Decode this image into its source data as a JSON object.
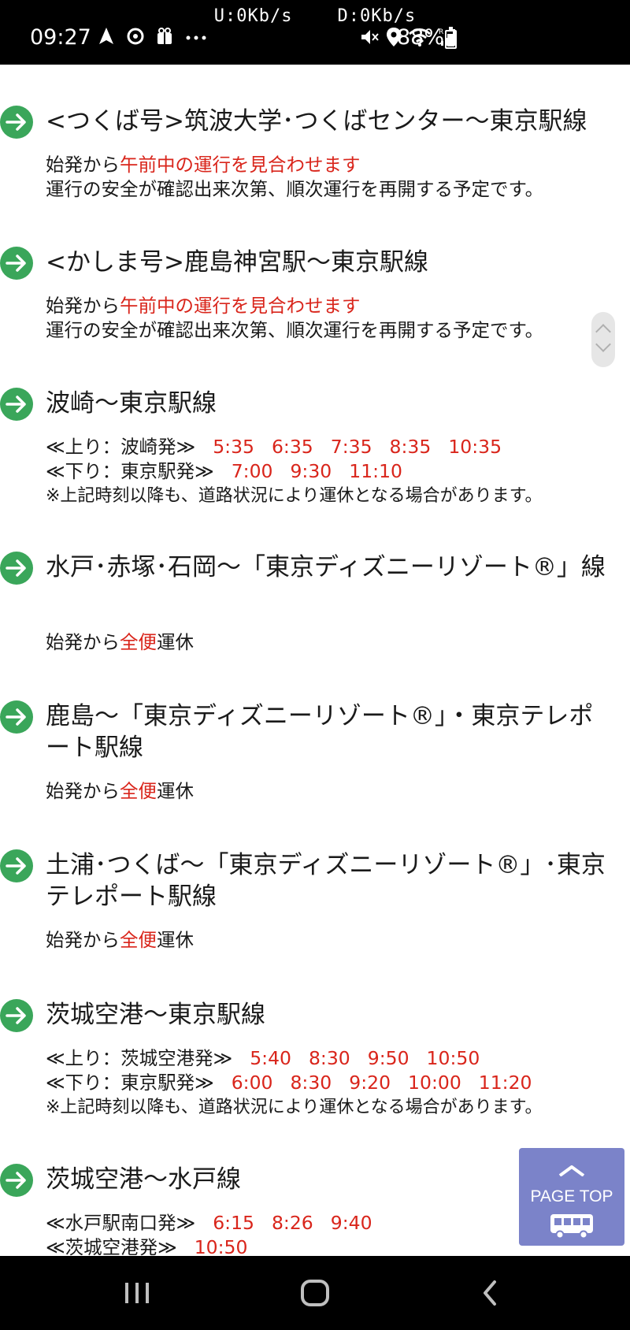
{
  "status_bar": {
    "net_speed": "U:0Kb/s    D:0Kb/s",
    "time": "09:27",
    "battery": "88%",
    "left_icons": [
      "navigation-icon",
      "sync-icon",
      "gift-icon",
      "more-icon"
    ],
    "right_icons": [
      "mute-icon",
      "location-icon",
      "wifi-icon",
      "signal-icon",
      "battery-icon"
    ]
  },
  "routes": [
    {
      "title": "<つくば号>筑波大学･つくばセンター〜東京駅線",
      "status_prefix": "始発から",
      "status_highlight": "午前中の運行を見合わせます",
      "status_suffix": "",
      "note": "運行の安全が確認出来次第、順次運行を再開する予定です。"
    },
    {
      "title": "<かしま号>鹿島神宮駅〜東京駅線",
      "status_prefix": "始発から",
      "status_highlight": "午前中の運行を見合わせます",
      "status_suffix": "",
      "note": "運行の安全が確認出来次第、順次運行を再開する予定です。"
    },
    {
      "title": "波崎〜東京駅線",
      "schedule": [
        {
          "label": "≪上り：波崎発≫",
          "times": [
            "5:35",
            "6:35",
            "7:35",
            "8:35",
            "10:35"
          ]
        },
        {
          "label": "≪下り：東京駅発≫",
          "times": [
            "7:00",
            "9:30",
            "11:10"
          ]
        }
      ],
      "note": "※上記時刻以降も、道路状況により運休となる場合があります。"
    },
    {
      "title": "水戸･赤塚･石岡〜「東京ディズニーリゾート®」線",
      "status_prefix": "始発から",
      "status_highlight": "全便",
      "status_suffix": "運休"
    },
    {
      "title": "鹿島〜「東京ディズニーリゾート®」・東京テレポート駅線",
      "status_prefix": "始発から",
      "status_highlight": "全便",
      "status_suffix": "運休"
    },
    {
      "title": "土浦･つくば〜「東京ディズニーリゾート®」･東京テレポート駅線",
      "status_prefix": "始発から",
      "status_highlight": "全便",
      "status_suffix": "運休"
    },
    {
      "title": "茨城空港〜東京駅線",
      "schedule": [
        {
          "label": "≪上り：茨城空港発≫",
          "times": [
            "5:40",
            "8:30",
            "9:50",
            "10:50"
          ]
        },
        {
          "label": "≪下り：東京駅発≫",
          "times": [
            "6:00",
            "8:30",
            "9:20",
            "10:00",
            "11:20"
          ]
        }
      ],
      "note": "※上記時刻以降も、道路状況により運休となる場合があります。"
    },
    {
      "title": "茨城空港〜水戸線",
      "schedule": [
        {
          "label": "≪水戸駅南口発≫",
          "times": [
            "6:15",
            "8:26",
            "9:40"
          ]
        },
        {
          "label": "≪茨城空港発≫",
          "times": [
            "10:50"
          ]
        }
      ]
    }
  ],
  "page_top": {
    "label": "PAGE TOP"
  },
  "nav_bar": {
    "buttons": [
      "recent-apps",
      "home",
      "back"
    ]
  },
  "colors": {
    "accent_red": "#d9251b",
    "arrow_green": "#3aa65a",
    "page_top_bg": "#7b83c9"
  }
}
